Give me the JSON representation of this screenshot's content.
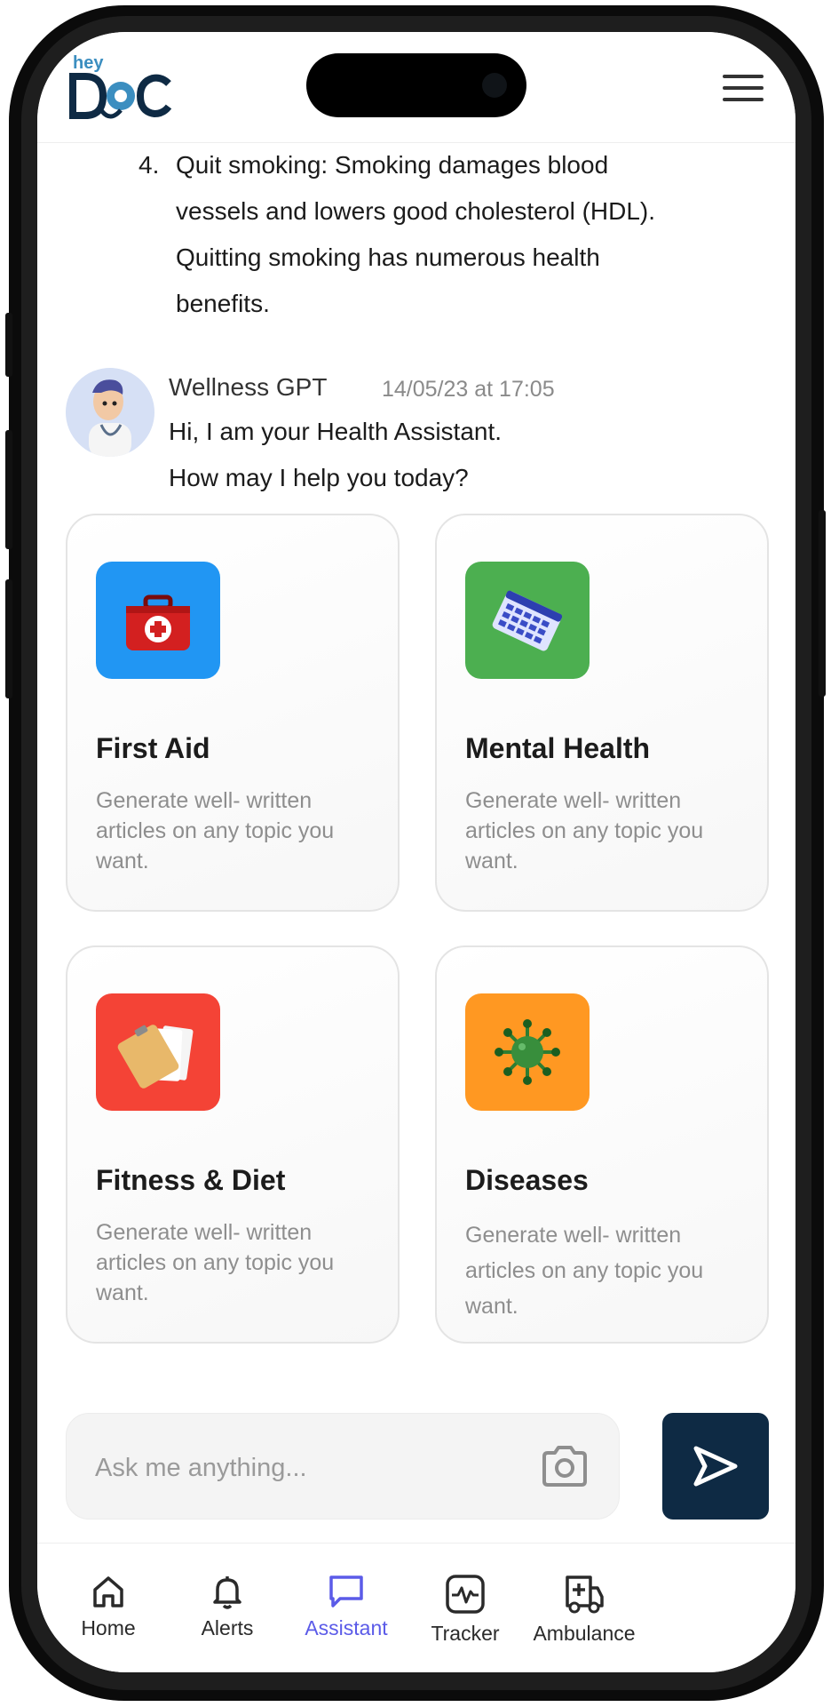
{
  "header": {
    "logo_small": "hey",
    "logo_main": "DOC",
    "menu_icon": "hamburger-icon"
  },
  "chat": {
    "list_item": {
      "number": "4.",
      "lines": [
        "Quit smoking: Smoking damages blood",
        "vessels and lowers good cholesterol (HDL).",
        "Quitting smoking has numerous health",
        "benefits."
      ]
    },
    "message": {
      "sender": "Wellness GPT",
      "timestamp": "14/05/23 at 17:05",
      "lines": [
        "Hi, I am your Health Assistant.",
        "How may I help you today?"
      ]
    }
  },
  "cards": [
    {
      "title": "First Aid",
      "description": "Generate well- written articles on any topic you want.",
      "icon": "first-aid-kit-icon",
      "color": "#2196f3"
    },
    {
      "title": "Mental Health",
      "description": "Generate well- written articles on any topic you want.",
      "icon": "calendar-icon",
      "color": "#4caf50"
    },
    {
      "title": "Fitness & Diet",
      "description": "Generate well- written articles on any topic you want.",
      "icon": "clipboard-icon",
      "color": "#f44336"
    },
    {
      "title": "Diseases",
      "description": "Generate well- written articles on any topic you want.",
      "icon": "virus-icon",
      "color": "#ff9822"
    }
  ],
  "composer": {
    "placeholder": "Ask me anything...",
    "camera_icon": "camera-icon",
    "send_icon": "send-icon"
  },
  "tabs": [
    {
      "label": "Home",
      "icon": "home-icon",
      "active": false
    },
    {
      "label": "Alerts",
      "icon": "bell-icon",
      "active": false
    },
    {
      "label": "Assistant",
      "icon": "chat-bubble-icon",
      "active": true
    },
    {
      "label": "Tracker",
      "icon": "pulse-icon",
      "active": false
    },
    {
      "label": "Ambulance",
      "icon": "ambulance-icon",
      "active": false
    }
  ],
  "colors": {
    "accent": "#5b5be8",
    "send_button": "#0e2a44",
    "logo_dark": "#0e2a44",
    "logo_light": "#3b8ec0"
  }
}
